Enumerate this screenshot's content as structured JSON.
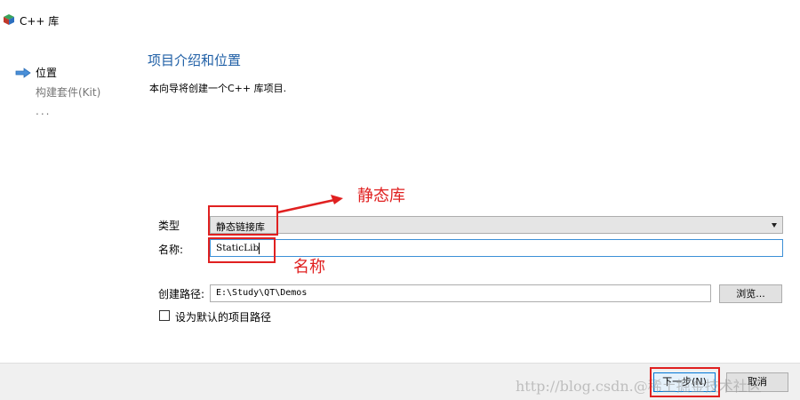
{
  "window": {
    "title": "C++ 库"
  },
  "sidebar": {
    "steps": [
      {
        "label": "位置",
        "current": true
      },
      {
        "label": "构建套件(Kit)",
        "current": false
      },
      {
        "label": "...",
        "current": false
      }
    ]
  },
  "page": {
    "heading": "项目介绍和位置",
    "description": "本向导将创建一个C++ 库项目."
  },
  "form": {
    "type_label": "类型",
    "type_value": "静态链接库",
    "name_label": "名称:",
    "name_value": "StaticLib",
    "path_label": "创建路径:",
    "path_value": "E:\\Study\\QT\\Demos",
    "browse_label": "浏览...",
    "default_path_label": "设为默认的项目路径",
    "default_path_checked": false
  },
  "footer": {
    "next_label": "下一步(N)",
    "cancel_label": "取消"
  },
  "annotations": {
    "type_note": "静态库",
    "name_note": "名称",
    "color": "#e02020"
  },
  "watermark": "http://blog.csdn.@稀土掘金技术社区",
  "colors": {
    "heading": "#1f5fa6",
    "focus_border": "#3c8fd6",
    "footer_bg": "#f0f0f0"
  }
}
